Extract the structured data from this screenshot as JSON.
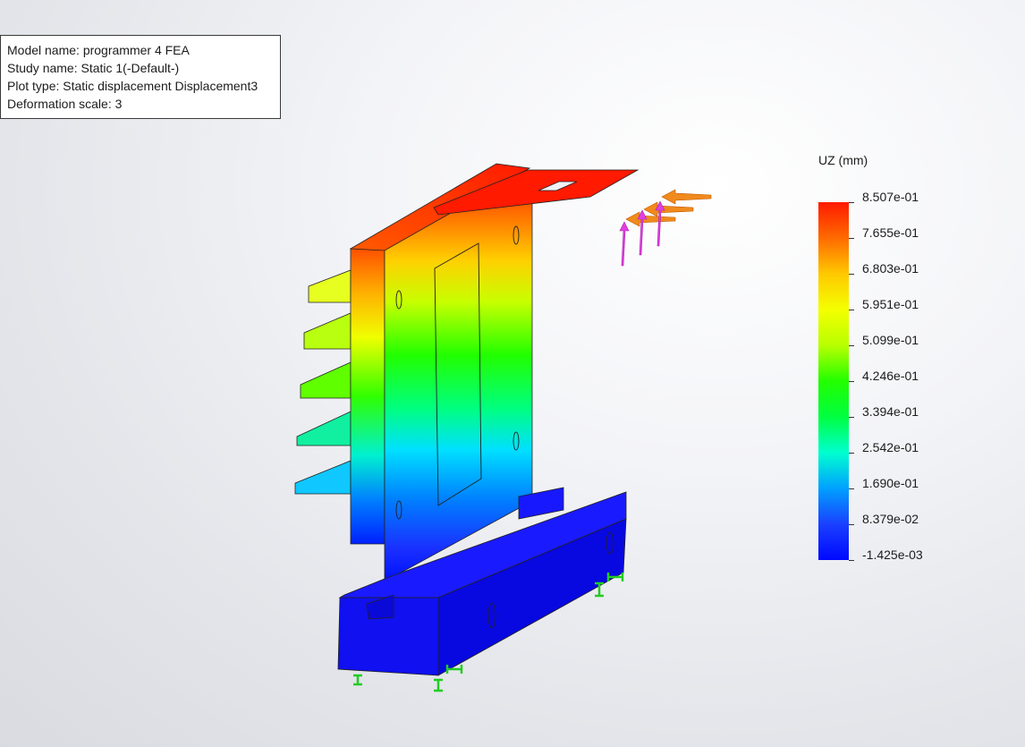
{
  "info": {
    "model_name": "Model name: programmer 4 FEA",
    "study_name": "Study name: Static 1(-Default-)",
    "plot_type": "Plot type: Static displacement Displacement3",
    "deformation_scale": "Deformation scale: 3"
  },
  "legend": {
    "title": "UZ (mm)",
    "labels": [
      "8.507e-01",
      "7.655e-01",
      "6.803e-01",
      "5.951e-01",
      "5.099e-01",
      "4.246e-01",
      "3.394e-01",
      "2.542e-01",
      "1.690e-01",
      "8.379e-02",
      "-1.425e-03"
    ]
  },
  "colors": {
    "max": "#ff1a00",
    "min": "#0008ff",
    "load_arrow": "#f08a1c",
    "load_arrow_vertical": "#e040e0",
    "fixture": "#22cc22"
  },
  "icons": [
    "force-arrow-icon",
    "fixture-icon"
  ]
}
